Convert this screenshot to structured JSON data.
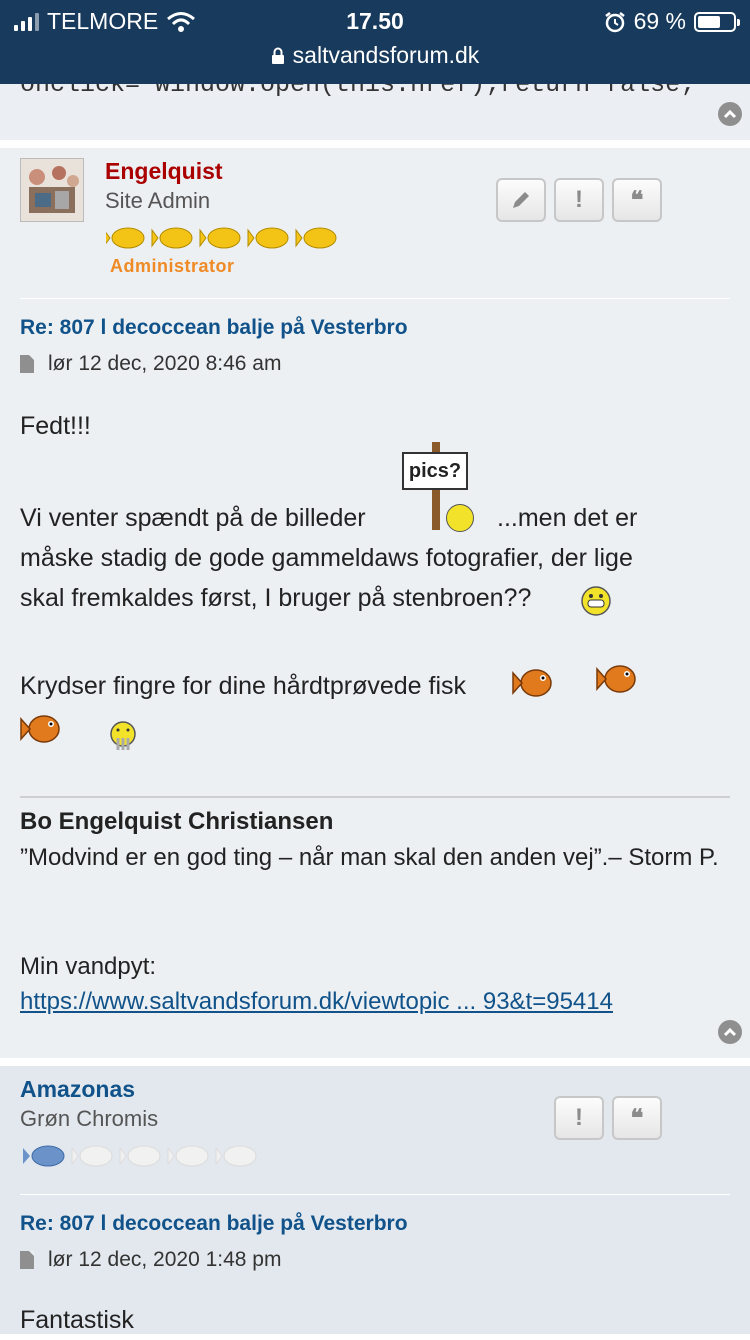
{
  "status_bar": {
    "carrier": "TELMORE",
    "time": "17.50",
    "battery": "69 %",
    "battery_level": 0.69,
    "url": "saltvandsforum.dk"
  },
  "cutoff_text": "onclick=\"window.open(this.href);return false;\"",
  "post1": {
    "author": "Engelquist",
    "rank": "Site Admin",
    "badge": "Administrator",
    "rank_fish_filled": 5,
    "rank_fish_total": 5,
    "title": "Re: 807 l decoccean balje på Vesterbro",
    "date": "lør 12 dec, 2020 8:46 am",
    "line1": "Fedt!!!",
    "line2a": "Vi venter spændt på de billeder",
    "sign_text": "pics?",
    "line2b": "...men det er",
    "line3": "måske stadig de gode gammeldaws fotografier, der lige",
    "line4": "skal fremkaldes først, I bruger på stenbroen??",
    "line5": "Krydser fingre for dine hårdtprøvede fisk",
    "sig_name": "Bo Engelquist Christiansen",
    "sig_quote": "”Modvind er en god ting – når man skal den anden vej”.– Storm P.",
    "sig_label": "Min vandpyt:",
    "sig_link": "https://www.saltvandsforum.dk/viewtopic ... 93&t=95414"
  },
  "post2": {
    "author": "Amazonas",
    "rank": "Grøn Chromis",
    "rank_fish_filled": 1,
    "rank_fish_total": 5,
    "title": "Re: 807 l decoccean balje på Vesterbro",
    "date": "lør 12 dec, 2020 1:48 pm",
    "text": "Fantastisk"
  },
  "icons": [
    "lock-icon",
    "wifi-icon",
    "alarm-icon",
    "edit-icon",
    "report-icon",
    "quote-icon",
    "back-to-top-icon",
    "post-icon"
  ],
  "colors": {
    "header": "#183a5c",
    "post_bg": "#ecf0f3",
    "admin_name": "#aa0000",
    "user_name": "#105289",
    "link": "#105289",
    "badge": "#f08a24"
  }
}
